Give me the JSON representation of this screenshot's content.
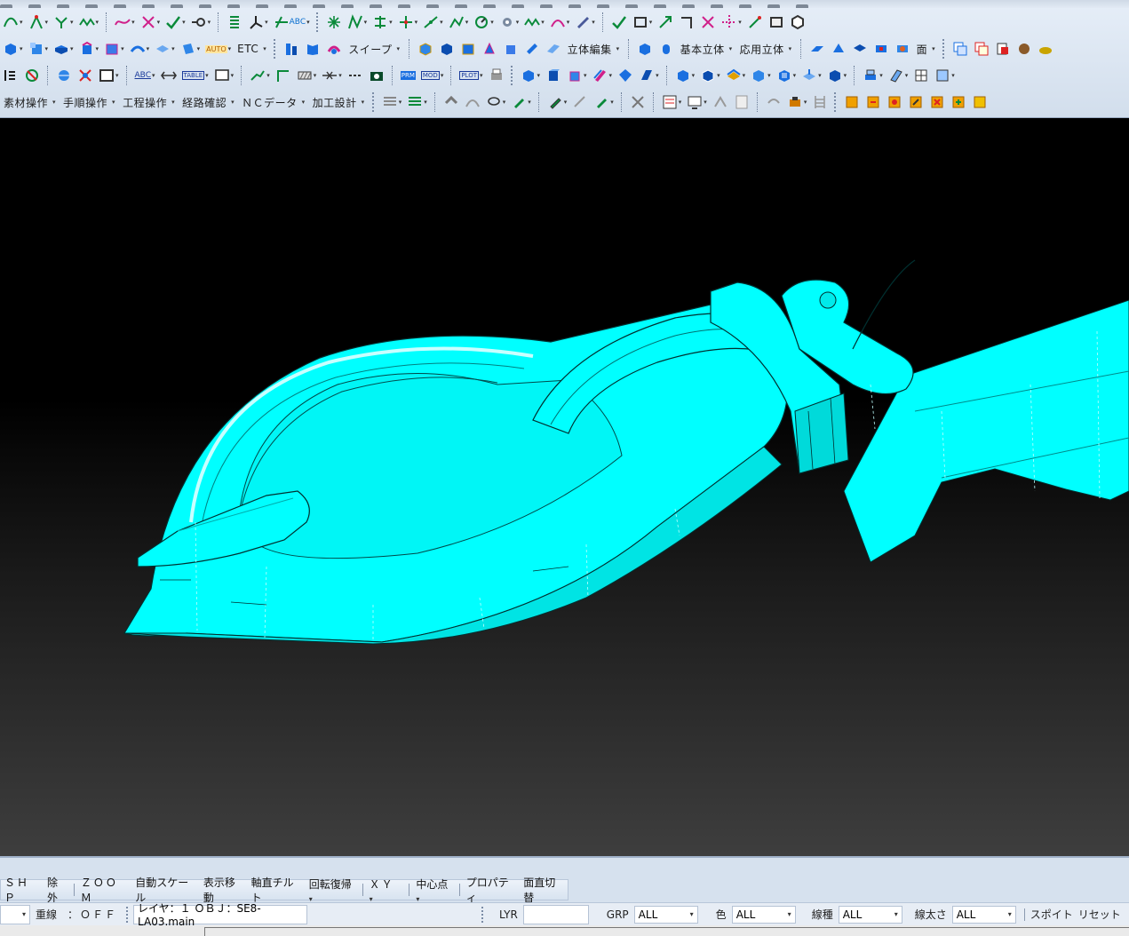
{
  "colors": {
    "model": "#00ffff",
    "model_shadow": "#00c4c4",
    "edge": "#003030",
    "background_top": "#000000",
    "background_bottom": "#3e3e3e"
  },
  "toolbar": {
    "row0_icons": [
      "flag-icon",
      "curve-icon",
      "wave-icon",
      "curve-pink-icon",
      "cross-icon",
      "check-icon",
      "node-icon",
      "spring-icon",
      "axis-icon",
      "text-abc-icon"
    ],
    "row0_right_icons": [
      "point-icon",
      "zigzag-icon",
      "grid-icon",
      "cross-plus-icon",
      "line-icon",
      "arc-icon",
      "circle-dot-icon",
      "gear-icon",
      "wave2-icon",
      "triangle-icon",
      "pen-icon",
      "check2-icon",
      "rect-icon",
      "arrow-icon",
      "corner-icon",
      "x-icon",
      "dotted-cross-icon",
      "measure-icon",
      "square-icon",
      "hexagon-icon"
    ],
    "row0_text": [
      "ABC"
    ],
    "row1_labels": {
      "etc": "ETC",
      "sweep": "スイープ",
      "solid_edit": "立体編集",
      "basic_solid": "基本立体",
      "applied_solid": "応用立体",
      "face": "面"
    },
    "row2_labels": {
      "abc": "ABC",
      "table": "TABLE",
      "auto": "AUTO",
      "prm": "PRM",
      "mod": "MOD",
      "plot": "PLOT"
    },
    "row3_menus": [
      "素材操作",
      "手順操作",
      "工程操作",
      "経路確認",
      "ＮＣデータ",
      "加工設計"
    ]
  },
  "bottom": {
    "commands": [
      "ＳＨＰ",
      "除外",
      "ＺＯＯＭ",
      "自動スケール",
      "表示移動",
      "軸直チルト",
      "回転復帰",
      "ＸＹ",
      "中心点",
      "プロパティ",
      "面直切替"
    ],
    "status": {
      "overlap_label": "重線",
      "overlap_value": "：ＯＦＦ",
      "layer_text": "レイヤ：１ ＯＢＪ：SE8-LA03.main",
      "lyr_label": "LYR",
      "lyr_value": "",
      "grp_label": "GRP",
      "grp_value": "ALL",
      "color_label": "色",
      "color_value": "ALL",
      "linetype_label": "線種",
      "linetype_value": "ALL",
      "linewidth_label": "線太さ",
      "linewidth_value": "ALL",
      "spoit_label": "スポイト",
      "reset_label": "リセット"
    }
  }
}
